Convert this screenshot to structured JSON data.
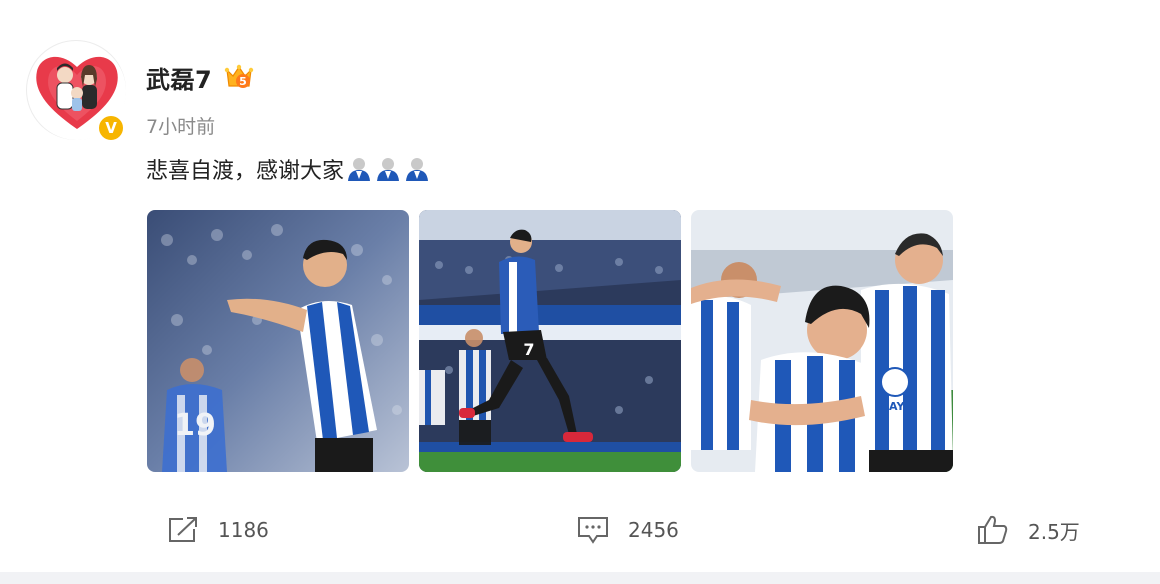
{
  "post": {
    "username": "武磊7",
    "time": "7小时前",
    "text": "悲喜自渡，感谢大家",
    "emojis": [
      "praying-hands-emoji",
      "praying-hands-emoji",
      "praying-hands-emoji"
    ],
    "verified_badge": "V",
    "vip_badge": "5"
  },
  "photos": [
    {
      "name": "celebration-photo-1",
      "shirt_number": "19",
      "sponsor": ""
    },
    {
      "name": "celebration-photo-2",
      "shirt_number": "7",
      "sponsor": ""
    },
    {
      "name": "celebration-photo-3",
      "shirt_number": "",
      "sponsor": "MAYA"
    }
  ],
  "actions": {
    "share_count": "1186",
    "comment_count": "2456",
    "like_count": "2.5万"
  },
  "colors": {
    "accent": "#f7b500",
    "text": "#222222",
    "muted": "#8a8a8a",
    "team_blue": "#1f58b8"
  }
}
